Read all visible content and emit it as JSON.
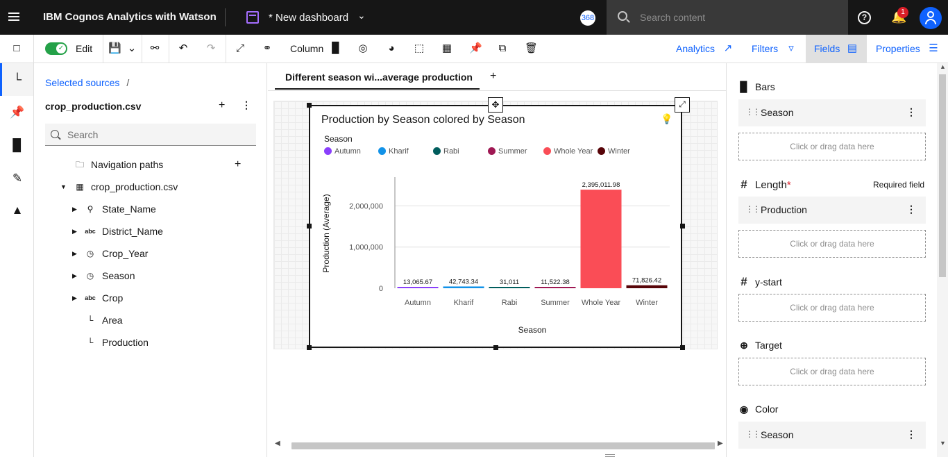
{
  "topbar": {
    "app_title": "IBM Cognos Analytics with Watson",
    "dashboard_name": "* New dashboard",
    "badge_368": "368",
    "search_placeholder": "Search content",
    "notification_count": "1"
  },
  "toolbar": {
    "edit_label": "Edit",
    "column_label": "Column",
    "analytics_label": "Analytics",
    "filters_label": "Filters",
    "fields_label": "Fields",
    "properties_label": "Properties"
  },
  "sources": {
    "breadcrumb_link": "Selected sources",
    "breadcrumb_sep": "/",
    "source_name": "crop_production.csv",
    "search_placeholder": "Search",
    "tree": [
      {
        "label": "Navigation paths",
        "icon": "folder-icon"
      },
      {
        "label": "crop_production.csv",
        "icon": "table-icon"
      },
      {
        "label": "State_Name",
        "icon": "location-icon"
      },
      {
        "label": "District_Name",
        "icon": "abc-icon"
      },
      {
        "label": "Crop_Year",
        "icon": "clock-icon"
      },
      {
        "label": "Season",
        "icon": "clock-icon"
      },
      {
        "label": "Crop",
        "icon": "abc-icon"
      },
      {
        "label": "Area",
        "icon": "measure-icon"
      },
      {
        "label": "Production",
        "icon": "measure-icon"
      }
    ]
  },
  "tab": {
    "active_label": "Different season wi...average production",
    "add_symbol": "+"
  },
  "viz": {
    "title": "Production by Season colored by Season",
    "legend_title": "Season"
  },
  "chart_data": {
    "type": "bar",
    "title": "Production by Season colored by Season",
    "xlabel": "Season",
    "ylabel": "Production (Average)",
    "categories": [
      "Autumn",
      "Kharif",
      "Rabi",
      "Summer",
      "Whole Year",
      "Winter"
    ],
    "values": [
      13065.67,
      42743.34,
      31011,
      11522.38,
      2395011.98,
      71826.42
    ],
    "value_labels": [
      "13,065.67",
      "42,743.34",
      "31,011",
      "11,522.38",
      "2,395,011.98",
      "71,826.42"
    ],
    "colors": [
      "#8a3ffc",
      "#1192e8",
      "#005d5d",
      "#9f1853",
      "#fa4d56",
      "#570408"
    ],
    "yticks": [
      0,
      1000000,
      2000000
    ],
    "ytick_labels": [
      "0",
      "1,000,000",
      "2,000,000"
    ],
    "ylim": [
      0,
      2700000
    ],
    "grid": true,
    "legend_title": "Season",
    "legend_position": "top-left"
  },
  "fields_panel": {
    "bars_label": "Bars",
    "bars_field": "Season",
    "length_label": "Length",
    "length_required_mark": "*",
    "required_text": "Required field",
    "length_field": "Production",
    "ystart_label": "y-start",
    "target_label": "Target",
    "color_label": "Color",
    "color_field": "Season",
    "drop_placeholder": "Click or drag data here"
  },
  "colors": {
    "accent": "#0f62fe",
    "topbar_bg": "#161616",
    "toggle_on": "#24a148"
  }
}
